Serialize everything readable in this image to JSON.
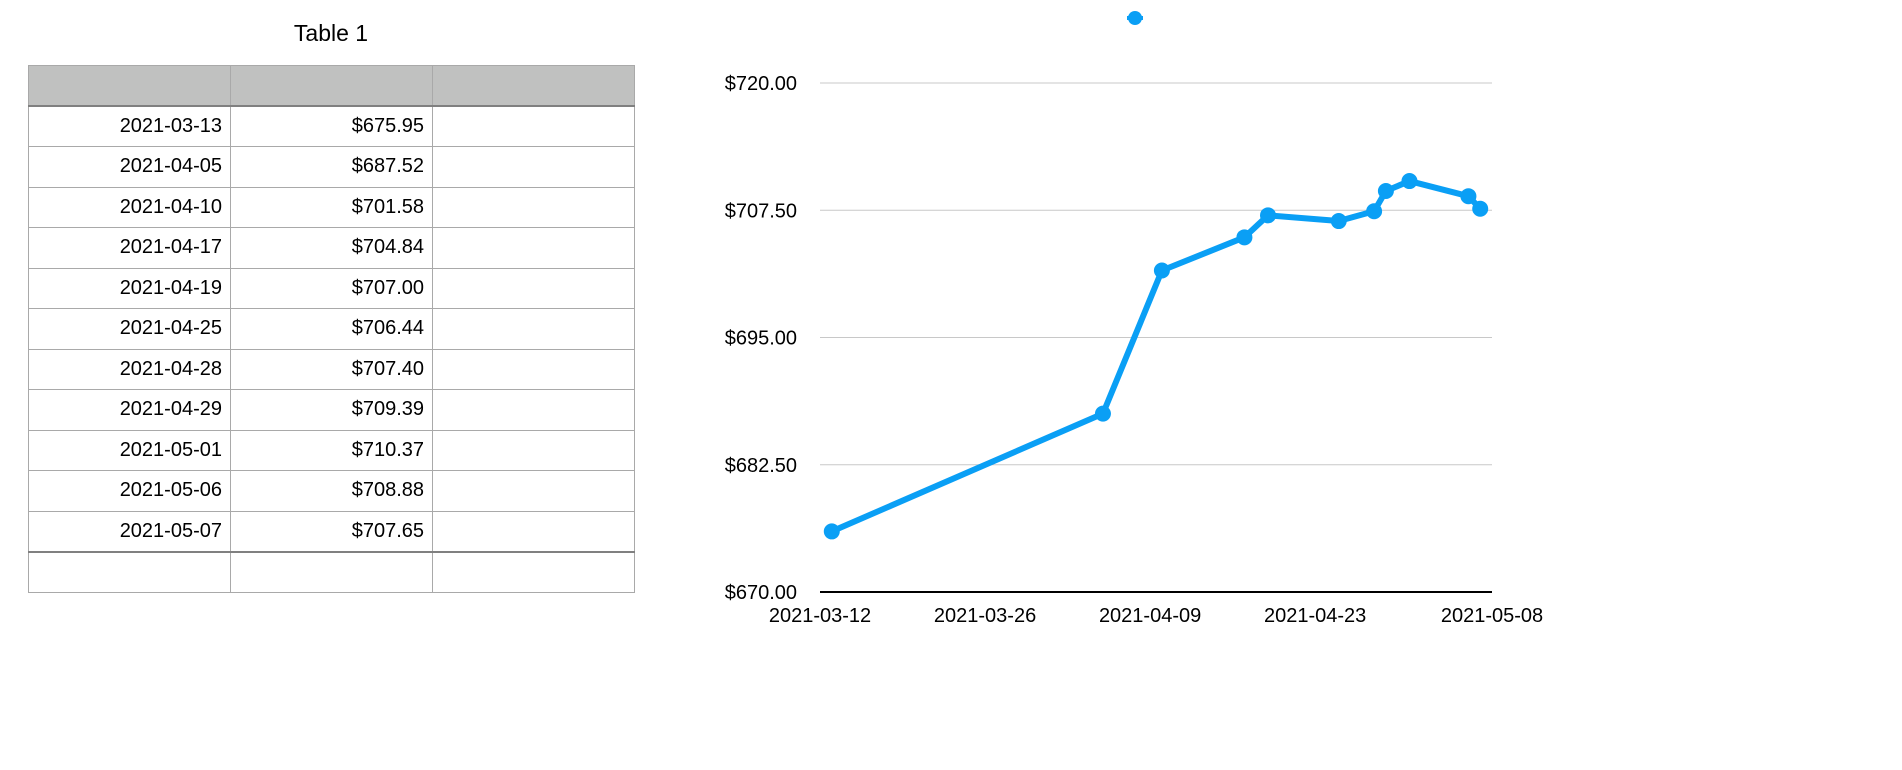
{
  "table": {
    "title": "Table 1",
    "header": [
      "",
      "",
      ""
    ],
    "rows": [
      [
        "2021-03-13",
        "$675.95",
        ""
      ],
      [
        "2021-04-05",
        "$687.52",
        ""
      ],
      [
        "2021-04-10",
        "$701.58",
        ""
      ],
      [
        "2021-04-17",
        "$704.84",
        ""
      ],
      [
        "2021-04-19",
        "$707.00",
        ""
      ],
      [
        "2021-04-25",
        "$706.44",
        ""
      ],
      [
        "2021-04-28",
        "$707.40",
        ""
      ],
      [
        "2021-04-29",
        "$709.39",
        ""
      ],
      [
        "2021-05-01",
        "$710.37",
        ""
      ],
      [
        "2021-05-06",
        "$708.88",
        ""
      ],
      [
        "2021-05-07",
        "$707.65",
        ""
      ]
    ]
  },
  "chart_data": {
    "type": "line",
    "title": "",
    "xlabel": "",
    "ylabel": "",
    "x": [
      "2021-03-13",
      "2021-04-05",
      "2021-04-10",
      "2021-04-17",
      "2021-04-19",
      "2021-04-25",
      "2021-04-28",
      "2021-04-29",
      "2021-05-01",
      "2021-05-06",
      "2021-05-07"
    ],
    "series": [
      {
        "values": [
          675.95,
          687.52,
          701.58,
          704.84,
          707.0,
          706.44,
          707.4,
          709.39,
          710.37,
          708.88,
          707.65
        ]
      }
    ],
    "xlim": [
      "2021-03-12",
      "2021-05-08"
    ],
    "ylim": [
      670,
      720
    ],
    "x_ticks": [
      "2021-03-12",
      "2021-03-26",
      "2021-04-09",
      "2021-04-23",
      "2021-05-08"
    ],
    "y_ticks": [
      "$670.00",
      "$682.50",
      "$695.00",
      "$707.50",
      "$720.00"
    ],
    "y_tick_values": [
      670,
      682.5,
      695,
      707.5,
      720
    ],
    "grid": true,
    "legend": "top-center",
    "colors": {
      "series": "#0a9ff5",
      "grid": "#c8c8c8",
      "axis": "#000000"
    }
  }
}
